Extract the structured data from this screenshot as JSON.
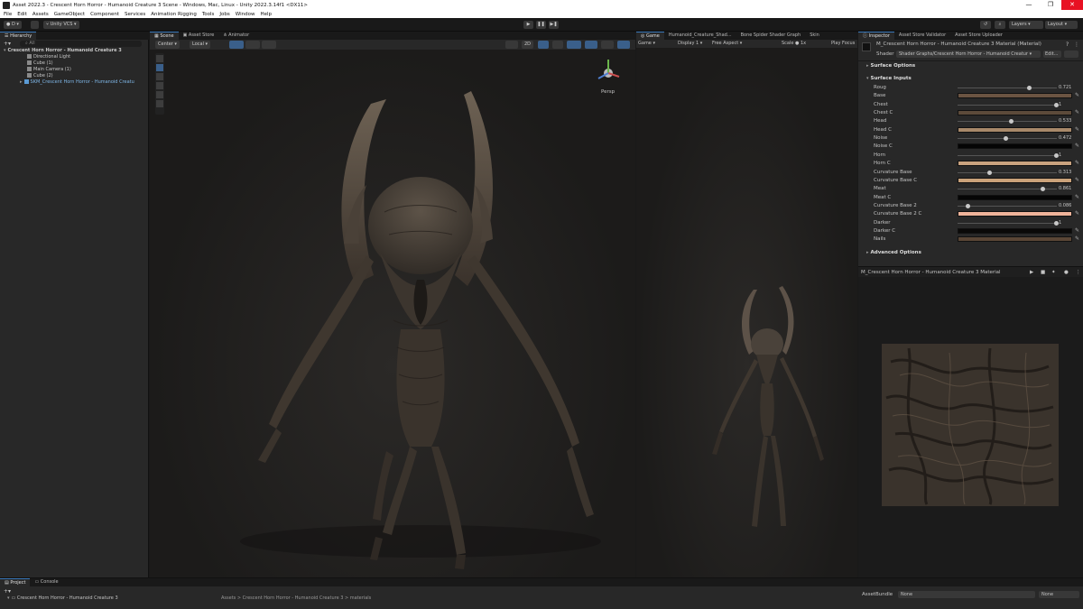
{
  "window": {
    "title": "Asset 2022.3 - Crescent Horn Horror - Humanoid Creature 3 Scene - Windows, Mac, Linux - Unity 2022.3.14f1 <DX11>",
    "min": "—",
    "max": "❐",
    "close": "✕"
  },
  "menu": [
    "File",
    "Edit",
    "Assets",
    "GameObject",
    "Component",
    "Services",
    "Animation Rigging",
    "Tools",
    "Jobs",
    "Window",
    "Help"
  ],
  "toolbar": {
    "account": "D",
    "vcs": "Unity VCS",
    "layers": "Layers",
    "layout": "Layout"
  },
  "hierarchy": {
    "tab": "Hierarchy",
    "search": "All",
    "scene": "Crescent Horn Horror - Humanoid Creature 3",
    "items": [
      "Directional Light",
      "Cube (1)",
      "Main Camera (1)",
      "Cube (2)",
      "SKM_Crescent Horn Horror - Humanoid Creatu"
    ]
  },
  "scene_tabs": [
    "Scene",
    "Asset Store",
    "Animator"
  ],
  "scene_toolbar": {
    "pivot": "Center",
    "space": "Local",
    "mode_2d": "2D",
    "persp": "Persp"
  },
  "game_tabs": [
    "Game",
    "Humanoid_Creature_Shad...",
    "Bone Spider Shader Graph",
    "Skin"
  ],
  "game_toolbar": {
    "mode": "Game",
    "display": "Display 1",
    "aspect": "Free Aspect",
    "scale_label": "Scale",
    "scale": "1x",
    "play_focus": "Play Focus"
  },
  "inspector": {
    "tabs": [
      "Inspector",
      "Asset Store Validator",
      "Asset Store Uploader"
    ],
    "material_name": "M_Crescent Horn Horror - Humanoid Creature 3 Material (Material)",
    "shader_label": "Shader",
    "shader_value": "Shader Graphs/Crescent Horn Horror - Humanoid Creatur",
    "edit": "Edit...",
    "surface_options": "Surface Options",
    "surface_inputs": "Surface Inputs",
    "advanced_options": "Advanced Options",
    "preview_title": "M_Crescent Horn Horror - Humanoid Creature 3 Material",
    "properties": [
      {
        "label": "Roug",
        "kind": "slider",
        "value": "0.721",
        "fraction": 0.721
      },
      {
        "label": "Base",
        "kind": "color",
        "color": "#6b5442"
      },
      {
        "label": "Chest",
        "kind": "slider",
        "value": "1",
        "fraction": 1
      },
      {
        "label": "Chest C",
        "kind": "color",
        "color": "#5c4a3a"
      },
      {
        "label": "Head",
        "kind": "slider",
        "value": "0.533",
        "fraction": 0.533
      },
      {
        "label": "Head C",
        "kind": "color",
        "color": "#a8896a"
      },
      {
        "label": "Noise",
        "kind": "slider",
        "value": "0.472",
        "fraction": 0.472
      },
      {
        "label": "Noise C",
        "kind": "color",
        "color": "#050505"
      },
      {
        "label": "Horn",
        "kind": "slider",
        "value": "1",
        "fraction": 1
      },
      {
        "label": "Horn C",
        "kind": "color",
        "color": "#c9a27e"
      },
      {
        "label": "Curvature Base",
        "kind": "slider",
        "value": "0.313",
        "fraction": 0.313
      },
      {
        "label": "Curvature Base C",
        "kind": "color",
        "color": "#caa27a"
      },
      {
        "label": "Meat",
        "kind": "slider",
        "value": "0.861",
        "fraction": 0.861
      },
      {
        "label": "Meat C",
        "kind": "color",
        "color": "#060606"
      },
      {
        "label": "Curvature Base 2",
        "kind": "slider",
        "value": "0.086",
        "fraction": 0.086
      },
      {
        "label": "Curvature Base 2 C",
        "kind": "color",
        "color": "#f0b49a"
      },
      {
        "label": "Darker",
        "kind": "slider",
        "value": "1",
        "fraction": 1
      },
      {
        "label": "Darker C",
        "kind": "color",
        "color": "#0a0908"
      },
      {
        "label": "Nails",
        "kind": "color",
        "color": "#5a4636"
      }
    ]
  },
  "bottom": {
    "tabs": [
      "Project",
      "Console"
    ],
    "project_item": "Crescent Horn Horror - Humanoid Creature 3",
    "path": "Assets > Crescent Horn Horror - Humanoid Creature 3 > materials",
    "assetbundle_label": "AssetBundle",
    "assetbundle_value": "None",
    "variant_value": "None"
  }
}
